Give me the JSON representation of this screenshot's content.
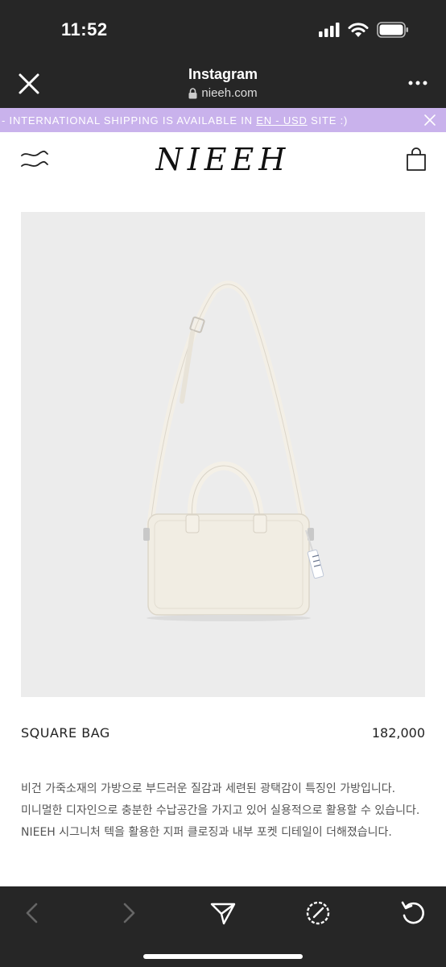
{
  "status_bar": {
    "time": "11:52"
  },
  "browser": {
    "title": "Instagram",
    "url": "nieeh.com",
    "icons": [
      "close-icon",
      "lock-icon",
      "more-icon"
    ]
  },
  "banner": {
    "prefix": "- INTERNATIONAL SHIPPING IS AVAILABLE IN ",
    "link_label": "EN - USD",
    "suffix": " SITE :)",
    "background": "#c9b2ec"
  },
  "header": {
    "logo": "NIEEH",
    "icons": [
      "menu-icon",
      "shopping-bag-icon"
    ]
  },
  "product": {
    "name": "SQUARE BAG",
    "price": "182,000",
    "description": [
      "비건 가죽소재의 가방으로 부드러운 질감과 세련된 광택감이 특징인 가방입니다.",
      "미니멀한 디자인으로 충분한 수납공간을 가지고 있어 실용적으로 활용할 수 있습니다.",
      "NIEEH 시그니처 텍을 활용한 지퍼 클로징과 내부 포켓 디테일이 더해졌습니다."
    ]
  },
  "toolbar": {
    "icons": [
      "back-icon",
      "forward-icon",
      "share-icon",
      "compass-icon",
      "reload-icon"
    ]
  }
}
